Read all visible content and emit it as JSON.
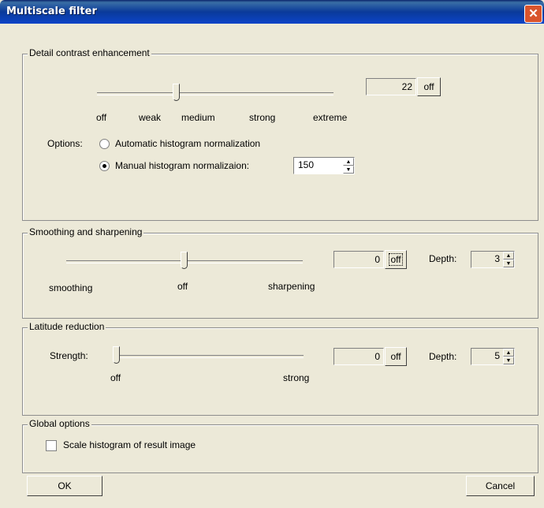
{
  "window": {
    "title": "Multiscale filter"
  },
  "detail": {
    "title": "Detail contrast enhancement",
    "slider_labels": [
      "off",
      "weak",
      "medium",
      "strong",
      "extreme"
    ],
    "value": "22",
    "off_label": "off",
    "options_label": "Options:",
    "auto_label": "Automatic histogram normalization",
    "manual_label": "Manual histogram normalizaion:",
    "manual_value": "150"
  },
  "smoothing": {
    "title": "Smoothing and sharpening",
    "label_left": "smoothing",
    "label_mid": "off",
    "label_right": "sharpening",
    "value": "0",
    "off_label": "off",
    "depth_label": "Depth:",
    "depth_value": "3"
  },
  "latitude": {
    "title": "Latitude reduction",
    "strength_label": "Strength:",
    "label_left": "off",
    "label_right": "strong",
    "value": "0",
    "off_label": "off",
    "depth_label": "Depth:",
    "depth_value": "5"
  },
  "global": {
    "title": "Global options",
    "scale_label": "Scale histogram of result image"
  },
  "buttons": {
    "ok": "OK",
    "cancel": "Cancel"
  }
}
